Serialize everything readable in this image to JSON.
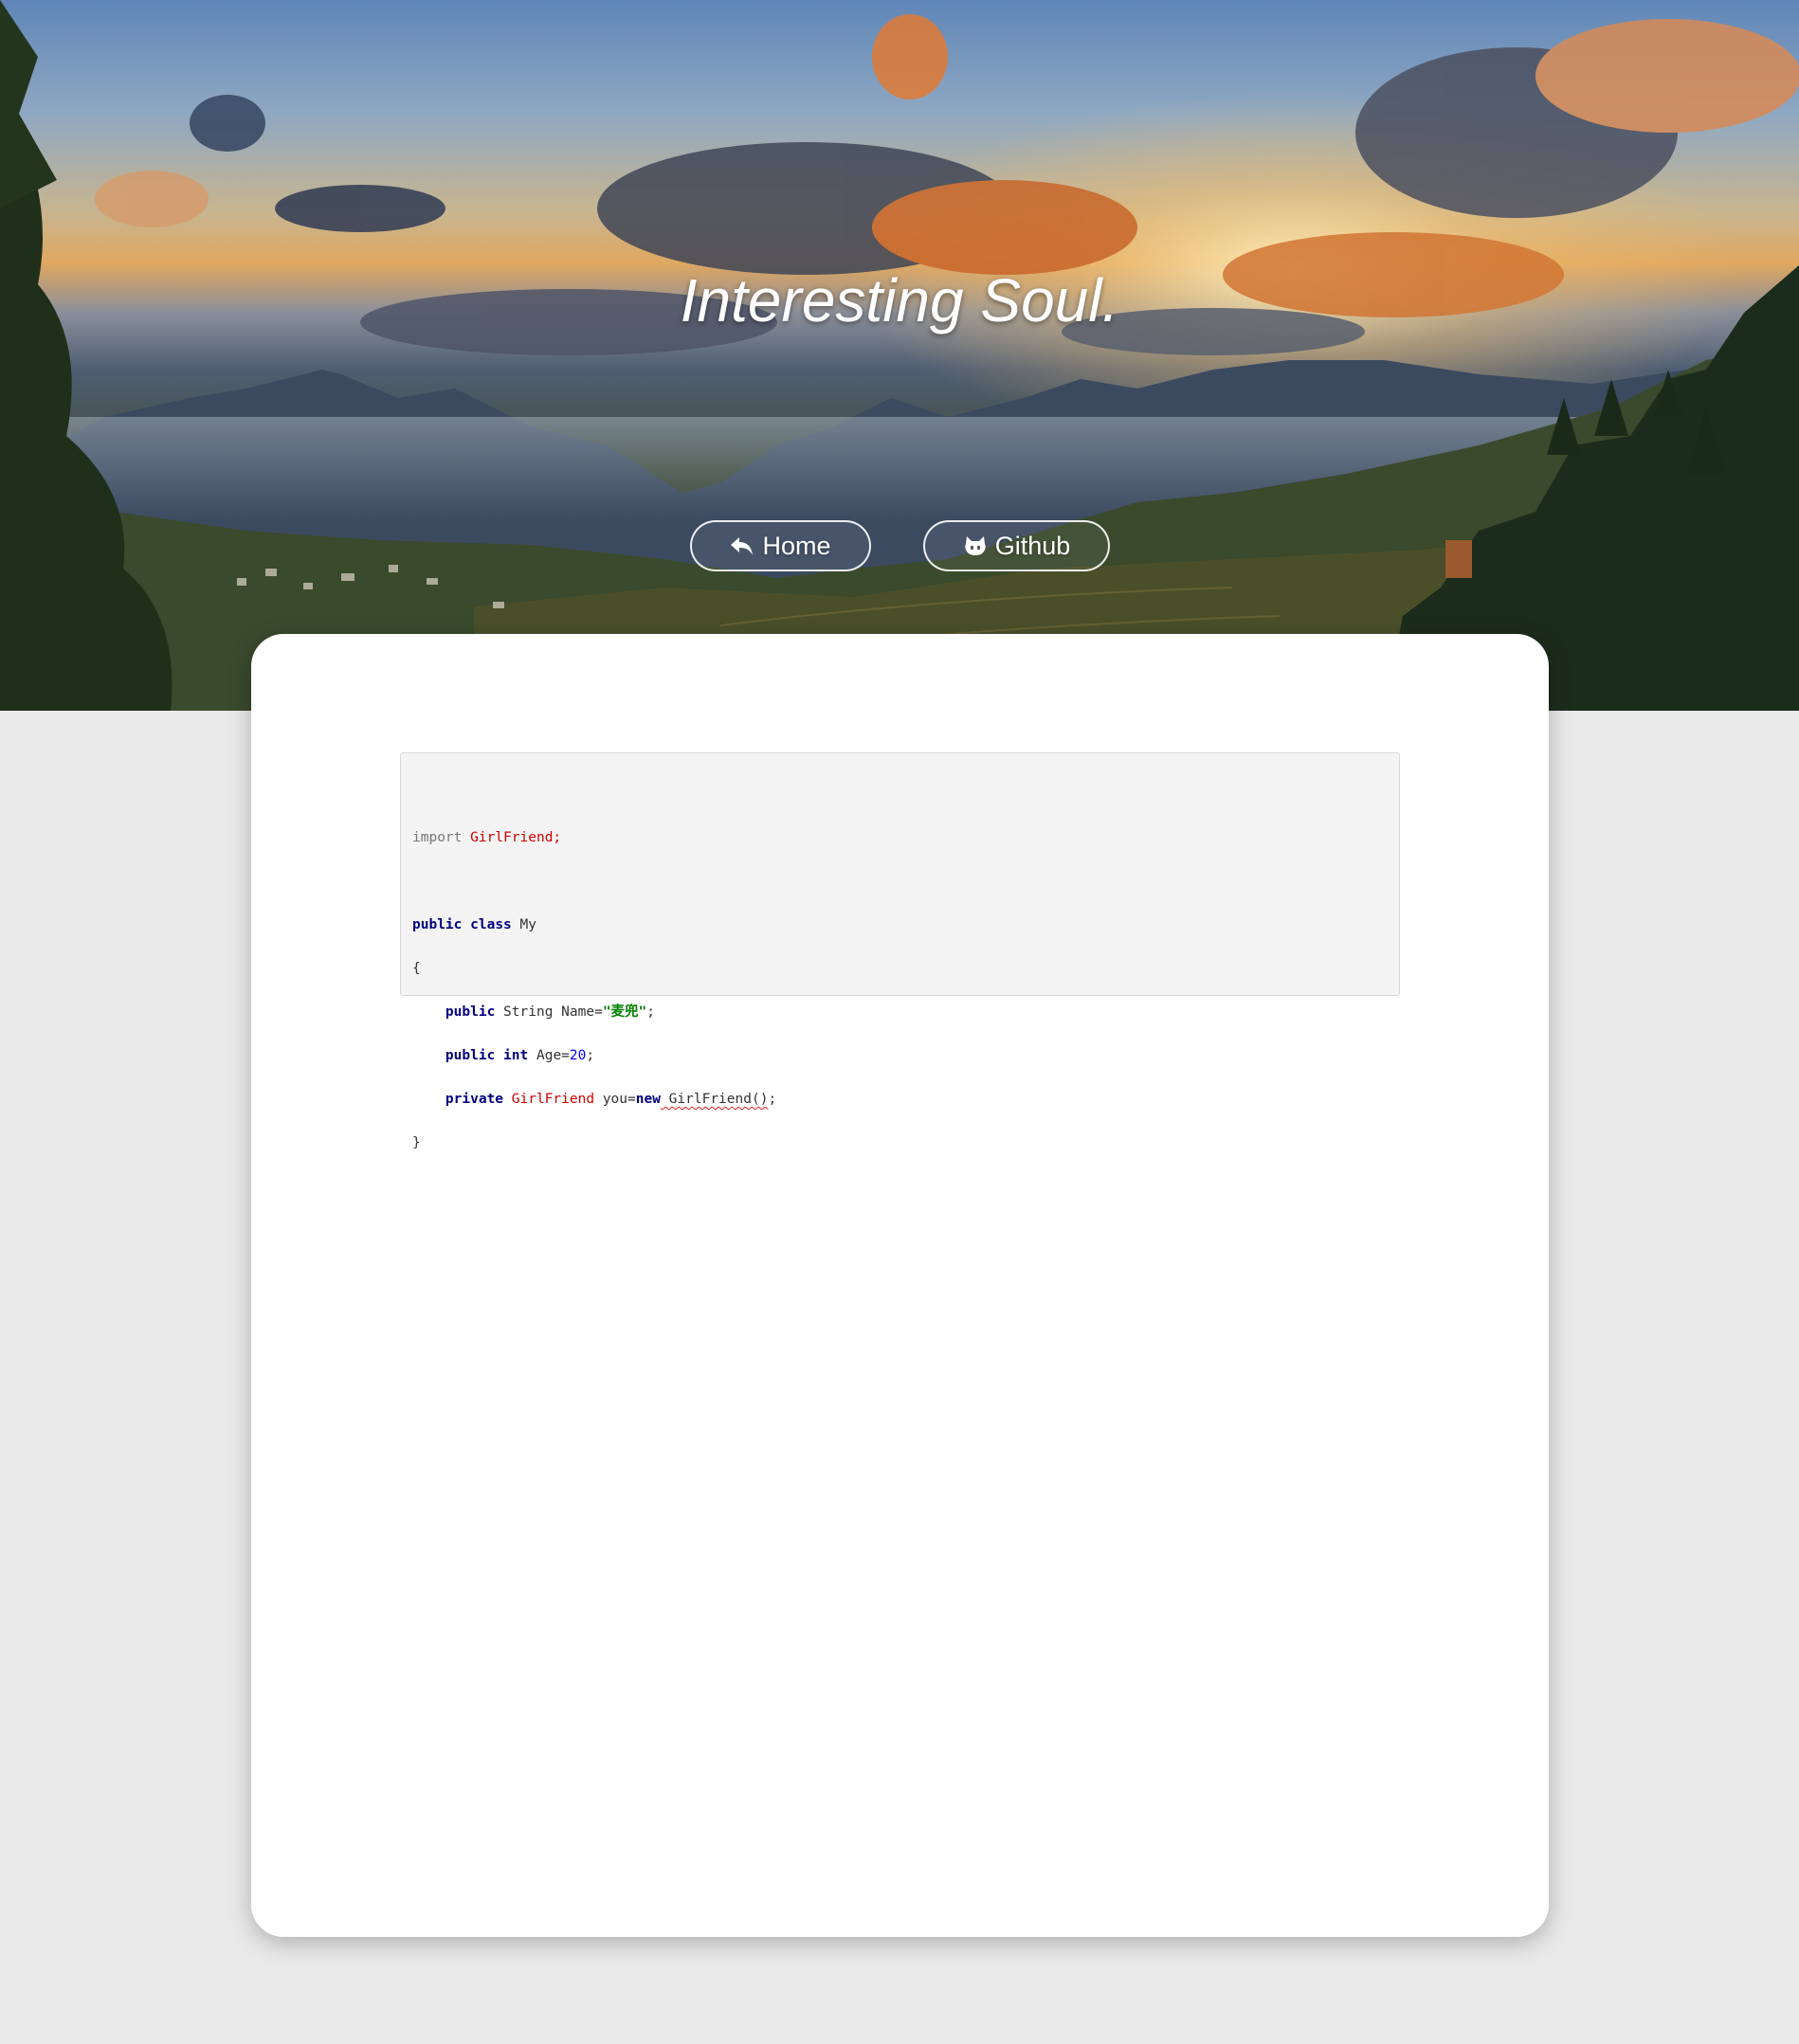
{
  "hero": {
    "title": "Interesting Soul.",
    "buttons": {
      "home": {
        "label": "Home",
        "icon": "reply-arrow-icon"
      },
      "github": {
        "label": "Github",
        "icon": "github-octocat-icon"
      }
    }
  },
  "code": {
    "import_kw": "import",
    "import_name": "GirlFriend;",
    "class_public": "public",
    "class_kw": "class",
    "class_name": "My",
    "open_brace": "{",
    "l1_public": "public",
    "l1_type": "String",
    "l1_field": "Name=",
    "l1_string": "\"麦兜\"",
    "l1_end": ";",
    "l2_public": "public",
    "l2_type": "int",
    "l2_field": "Age=",
    "l2_num": "20",
    "l2_end": ";",
    "l3_private": "private",
    "l3_type": "GirlFriend",
    "l3_field": "you=",
    "l3_new": "new",
    "l3_ctor": " GirlFriend()",
    "l3_end": ";",
    "close_brace": "}"
  }
}
